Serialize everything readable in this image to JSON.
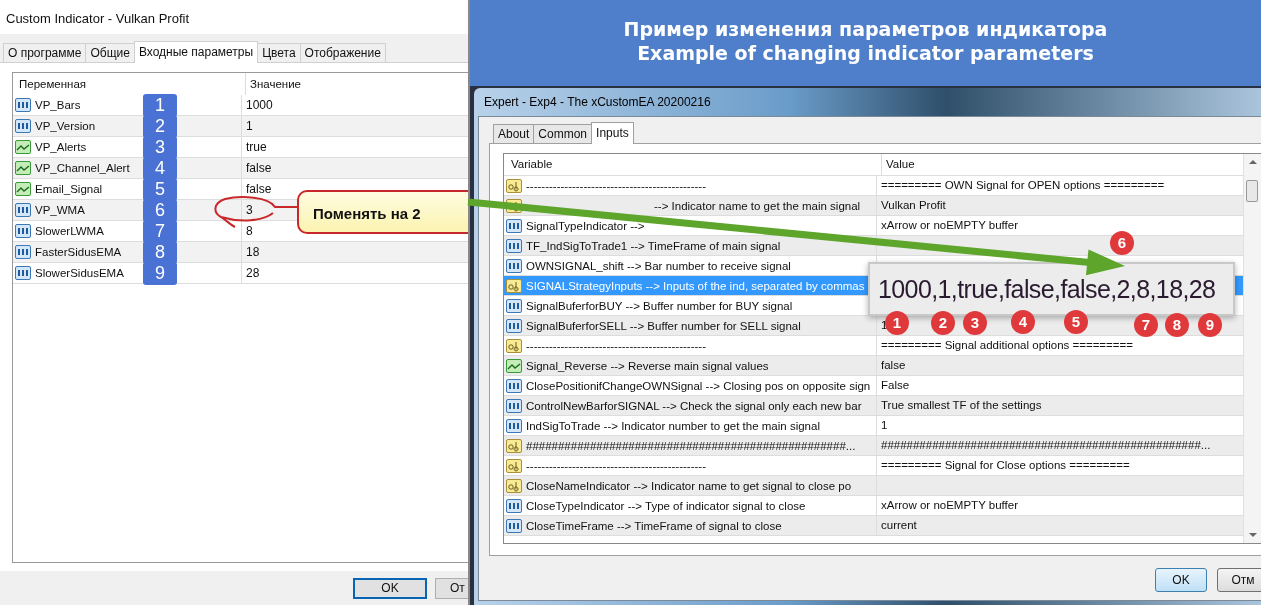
{
  "left_dialog": {
    "title": "Custom Indicator - Vulkan Profit",
    "tabs": [
      {
        "label": "О программе",
        "selected": false
      },
      {
        "label": "Общие",
        "selected": false
      },
      {
        "label": "Входные параметры",
        "selected": true
      },
      {
        "label": "Цвета",
        "selected": false
      },
      {
        "label": "Отображение",
        "selected": false
      }
    ],
    "columns": [
      "Переменная",
      "Значение"
    ],
    "rows": [
      {
        "kind": "number",
        "name": "VP_Bars",
        "value": "1000",
        "badge": "1"
      },
      {
        "kind": "number",
        "name": "VP_Version",
        "value": "1",
        "badge": "2"
      },
      {
        "kind": "bool",
        "name": "VP_Alerts",
        "value": "true",
        "badge": "3"
      },
      {
        "kind": "bool",
        "name": "VP_Channel_Alert",
        "value": "false",
        "badge": "4"
      },
      {
        "kind": "bool",
        "name": "Email_Signal",
        "value": "false",
        "badge": "5"
      },
      {
        "kind": "number",
        "name": "VP_WMA",
        "value": "3",
        "badge": "6"
      },
      {
        "kind": "number",
        "name": "SlowerLWMA",
        "value": "8",
        "badge": "7"
      },
      {
        "kind": "number",
        "name": "FasterSidusEMA",
        "value": "18",
        "badge": "8"
      },
      {
        "kind": "number",
        "name": "SlowerSidusEMA",
        "value": "28",
        "badge": "9"
      }
    ],
    "buttons": [
      "OK",
      "От"
    ]
  },
  "callout": {
    "text": "Поменять на 2"
  },
  "banner": {
    "lines": [
      "Пример изменения параметров индикатора",
      "Example of changing indicator parameters"
    ]
  },
  "right_dialog": {
    "title": "Expert - Exp4 - The xCustomEA 20200216",
    "tabs": [
      {
        "label": "About",
        "selected": false
      },
      {
        "label": "Common",
        "selected": false
      },
      {
        "label": "Inputs",
        "selected": true
      }
    ],
    "columns": [
      "Variable",
      "Value"
    ],
    "rows": [
      {
        "kind": "text",
        "name": "-----------------------------------------------",
        "value": "=========   OWN Signal for OPEN options =========",
        "selected": false
      },
      {
        "kind": "text",
        "name": "--> Indicator name to get the main signal",
        "name_start_covered": true,
        "value": "Vulkan Profit",
        "selected": false
      },
      {
        "kind": "number",
        "name": "SignalTypeIndicator -->",
        "value": "xArrow or noEMPTY buffer",
        "selected": false
      },
      {
        "kind": "number",
        "name": "TF_IndSigToTrade1 --> TimeFrame of main signal",
        "selected": false
      },
      {
        "kind": "number",
        "name": "OWNSIGNAL_shift --> Bar number to receive signal",
        "selected": false
      },
      {
        "kind": "text",
        "name": "SIGNALStrategyInputs --> Inputs of the ind, separated by commas",
        "selected": true
      },
      {
        "kind": "number",
        "name": "SignalBuferforBUY --> Buffer number for BUY signal",
        "selected": false
      },
      {
        "kind": "number",
        "name": "SignalBuferforSELL --> Buffer number for SELL signal",
        "value": "1",
        "selected": false
      },
      {
        "kind": "text",
        "name": "-----------------------------------------------",
        "value": "=========   Signal additional options =========",
        "selected": false
      },
      {
        "kind": "bool",
        "name": "Signal_Reverse --> Reverse main signal values",
        "value": "false",
        "selected": false
      },
      {
        "kind": "number",
        "name": "ClosePositionifChangeOWNSignal --> Closing pos on opposite sign",
        "value": "False",
        "selected": false
      },
      {
        "kind": "number",
        "name": "ControlNewBarforSIGNAL --> Check the signal only each new bar",
        "value": "True smallest TF of the settings",
        "selected": false
      },
      {
        "kind": "number",
        "name": "IndSigToTrade --> Indicator number to get the main signal",
        "value": "1",
        "selected": false
      },
      {
        "kind": "text",
        "name": "##################################################...",
        "value": "##################################################...",
        "selected": false
      },
      {
        "kind": "text",
        "name": "-----------------------------------------------",
        "value": "=========   Signal for Close options =========",
        "selected": false
      },
      {
        "kind": "text",
        "name": "CloseNameIndicator --> Indicator name to get signal to close po",
        "selected": false
      },
      {
        "kind": "number",
        "name": "CloseTypeIndicator --> Type of indicator signal to close",
        "value": "xArrow or noEMPTY buffer",
        "selected": false
      },
      {
        "kind": "number",
        "name": "CloseTimeFrame --> TimeFrame of signal to close",
        "value": "current",
        "selected": false
      }
    ],
    "buttons": [
      "OK",
      "Отм"
    ]
  },
  "zoom_overlay": {
    "text": "1000,1,true,false,false,2,8,18,28",
    "markers": [
      "1",
      "2",
      "3",
      "4",
      "5",
      "6",
      "7",
      "8",
      "9"
    ]
  }
}
